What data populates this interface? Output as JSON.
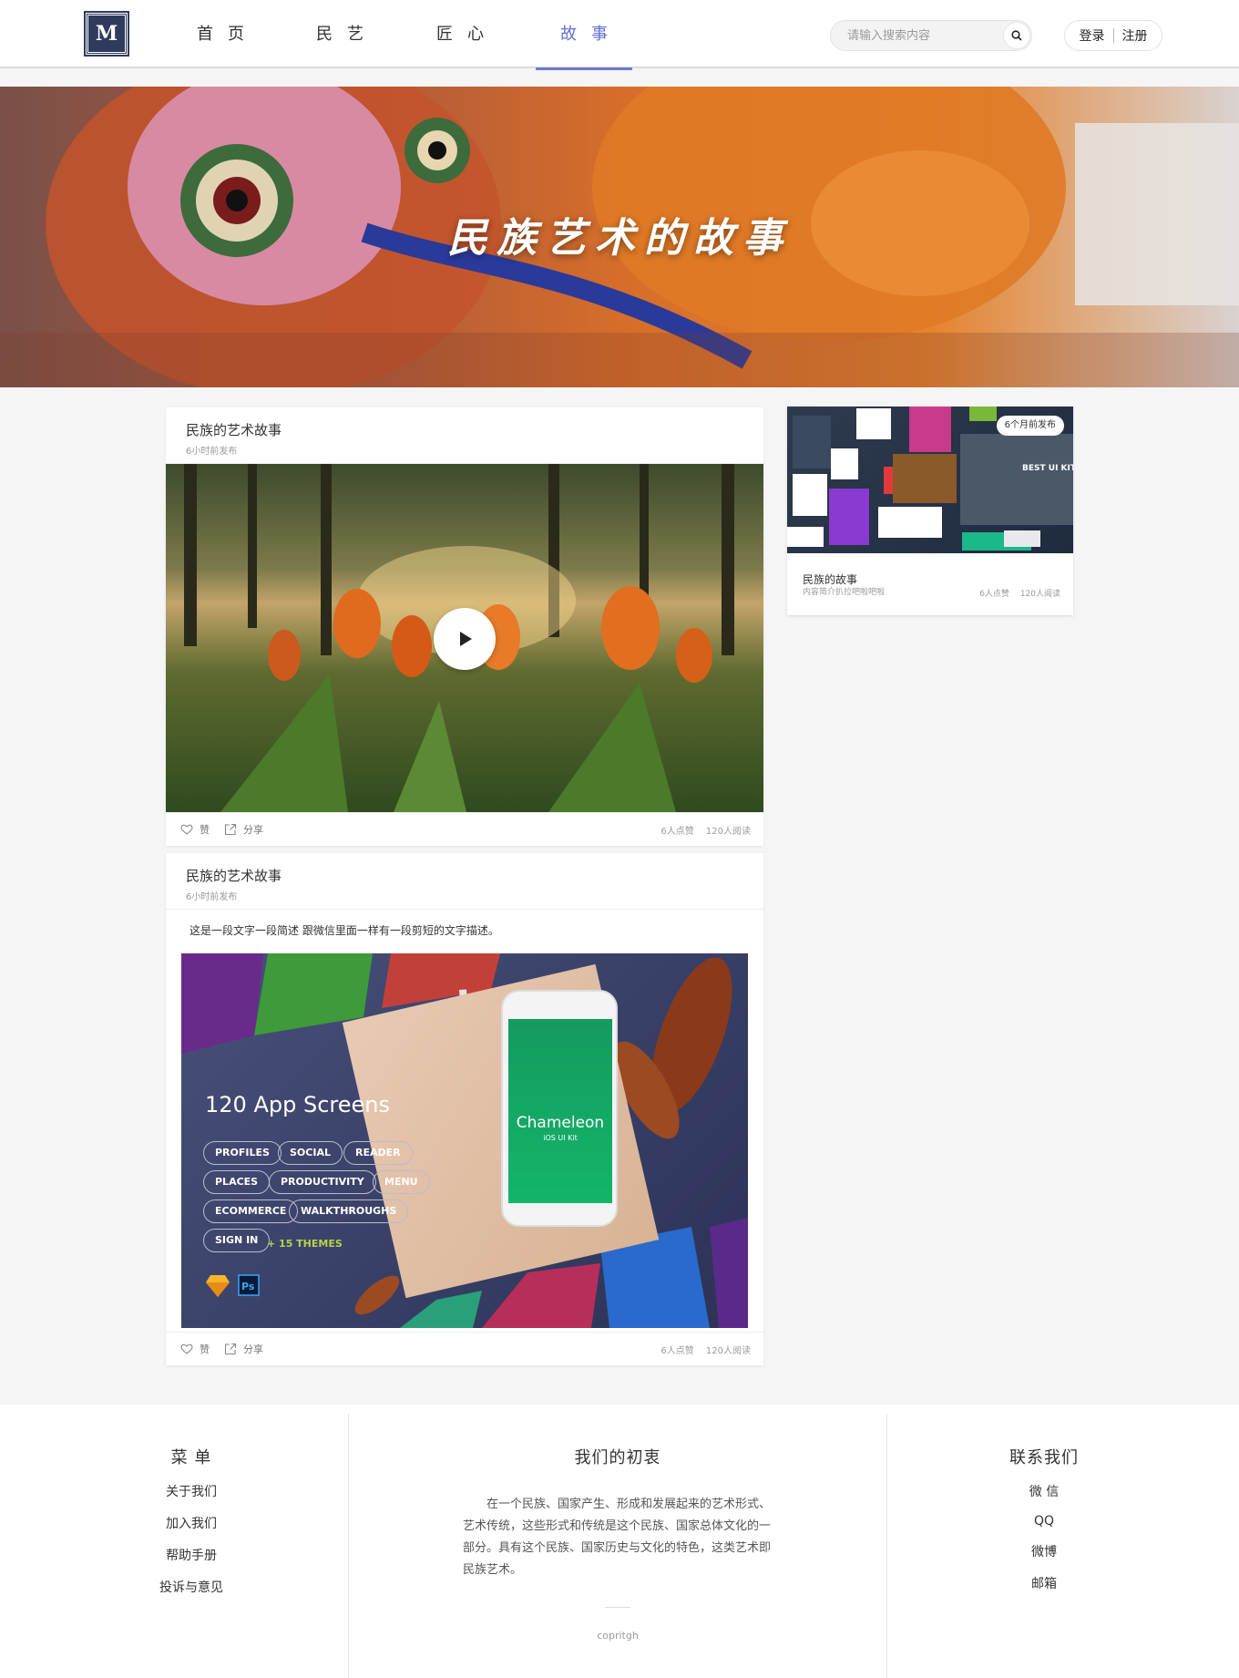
{
  "header": {
    "logo_text": "M",
    "nav": [
      "首页",
      "民艺",
      "匠心",
      "故事"
    ],
    "active_nav_index": 3,
    "search_placeholder": "请输入搜索内容",
    "login": "登录",
    "register": "注册"
  },
  "banner": {
    "title": "民族艺术的故事"
  },
  "posts": [
    {
      "title": "民族的艺术故事",
      "time": "6小时前发布",
      "like_label": "赞",
      "share_label": "分享",
      "likes": "6人点赞",
      "reads": "120人阅读"
    },
    {
      "title": "民族的艺术故事",
      "time": "6小时前发布",
      "description": "这是一段文字一段简述 跟微信里面一样有一段剪短的文字描述。",
      "promo": {
        "headline": "120 App Screens",
        "tags": [
          "PROFILES",
          "SOCIAL",
          "READER",
          "PLACES",
          "PRODUCTIVITY",
          "MENU",
          "ECOMMERCE",
          "WALKTHROUGHS",
          "SIGN IN"
        ],
        "themes": "+ 15 THEMES",
        "brand": "Chameleon",
        "brand_sub": "iOS UI Kit"
      },
      "like_label": "赞",
      "share_label": "分享",
      "likes": "6人点赞",
      "reads": "120人阅读"
    }
  ],
  "side_card": {
    "badge": "6个月前发布",
    "title": "民族的故事",
    "description": "内容简介扒拉吧啦吧啦",
    "likes": "6人点赞",
    "reads": "120人阅读",
    "image_caption": "BEST UI KIT EV"
  },
  "footer": {
    "menu_title": "菜 单",
    "menu_items": [
      "关于我们",
      "加入我们",
      "帮助手册",
      "投诉与意见"
    ],
    "about_title": "我们的初衷",
    "about_text": "在一个民族、国家产生、形成和发展起来的艺术形式、艺术传统，这些形式和传统是这个民族、国家总体文化的一部分。具有这个民族、国家历史与文化的特色，这类艺术即民族艺术。",
    "copyright": "copritgh",
    "contact_title": "联系我们",
    "contact_items": [
      "微 信",
      "QQ",
      "微博",
      "邮箱"
    ]
  },
  "colors": {
    "accent": "#6670d0",
    "logo_bg": "#2f3a5c",
    "themes_green": "#b4d44a"
  }
}
